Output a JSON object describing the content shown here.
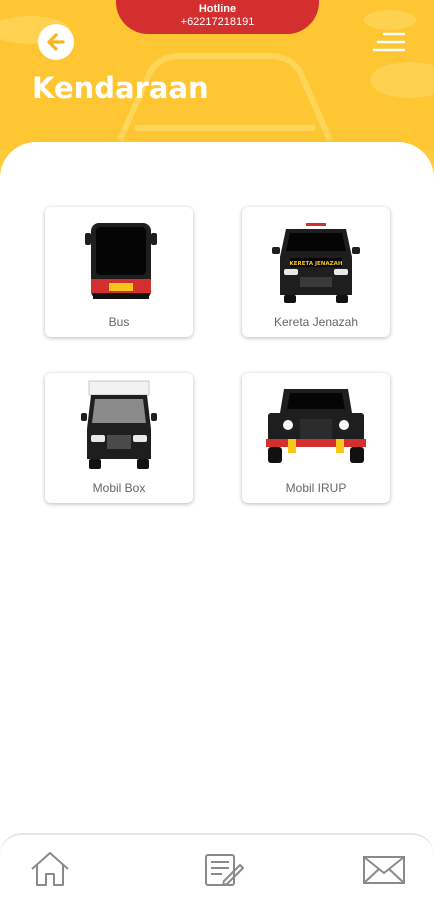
{
  "hotline": {
    "title": "Hotline",
    "number": "+62217218191"
  },
  "header": {
    "title": "Kendaraan"
  },
  "vehicles": [
    {
      "label": "Bus",
      "icon": "bus-icon"
    },
    {
      "label": "Kereta Jenazah",
      "icon": "hearse-icon",
      "sign": "KERETA JENAZAH"
    },
    {
      "label": "Mobil Box",
      "icon": "box-truck-icon"
    },
    {
      "label": "Mobil IRUP",
      "icon": "jeep-icon"
    }
  ],
  "bottom_nav": [
    {
      "icon": "home-icon"
    },
    {
      "icon": "form-edit-icon"
    },
    {
      "icon": "mail-icon"
    }
  ],
  "colors": {
    "header": "#FEC632",
    "hotline": "#D42F2F",
    "vehicle": "#1E1E1E",
    "tail_light": "#D42F2F",
    "plate": "#F6C71A"
  }
}
